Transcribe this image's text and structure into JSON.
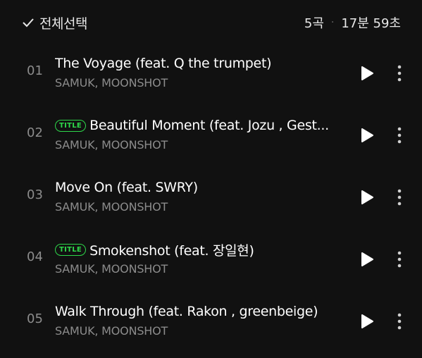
{
  "header": {
    "select_all_label": "전체선택",
    "track_count": "5곡",
    "separator": "·",
    "total_duration": "17분 59초"
  },
  "tracks": [
    {
      "number": "01",
      "title": "The Voyage (feat. Q the trumpet)",
      "artist": "SAMUK, MOONSHOT",
      "badge": ""
    },
    {
      "number": "02",
      "title": "Beautiful Moment (feat. Jozu , Gest...",
      "artist": "SAMUK, MOONSHOT",
      "badge": "TITLE"
    },
    {
      "number": "03",
      "title": "Move On (feat. SWRY)",
      "artist": "SAMUK, MOONSHOT",
      "badge": ""
    },
    {
      "number": "04",
      "title": "Smokenshot (feat. 장일현)",
      "artist": "SAMUK, MOONSHOT",
      "badge": "TITLE"
    },
    {
      "number": "05",
      "title": "Walk Through (feat. Rakon , greenbeige)",
      "artist": "SAMUK, MOONSHOT",
      "badge": ""
    }
  ],
  "icons": {
    "check": "check-icon",
    "play": "play-icon",
    "more": "more-vertical-icon"
  },
  "colors": {
    "background": "#111111",
    "accent_green": "#2ed84a",
    "text_primary": "#ffffff",
    "text_secondary": "#8c8c8c"
  }
}
